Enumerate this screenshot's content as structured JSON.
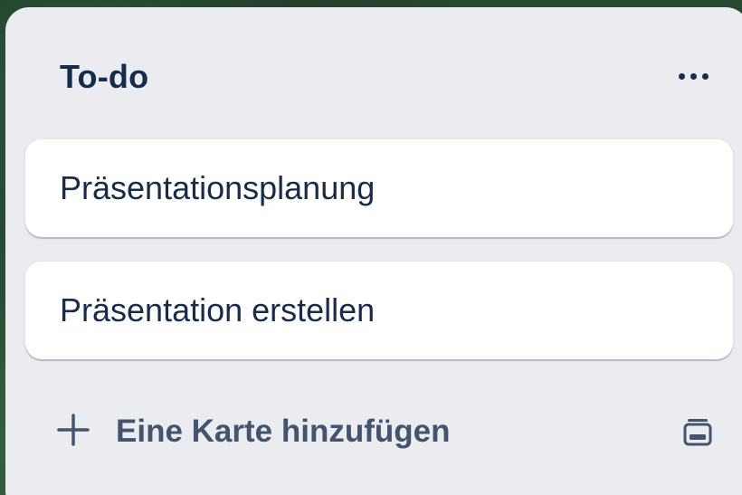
{
  "list": {
    "title": "To-do",
    "more_icon": "more-horizontal-icon",
    "cards": [
      {
        "title": "Präsentationsplanung"
      },
      {
        "title": "Präsentation erstellen"
      }
    ],
    "composer": {
      "add_label": "Eine Karte hinzufügen",
      "add_icon": "plus-icon",
      "template_icon": "card-template-icon"
    }
  },
  "colors": {
    "list_bg": "#ebecf0",
    "card_bg": "#ffffff",
    "title_text": "#172b4d",
    "muted_text": "#44546f"
  }
}
